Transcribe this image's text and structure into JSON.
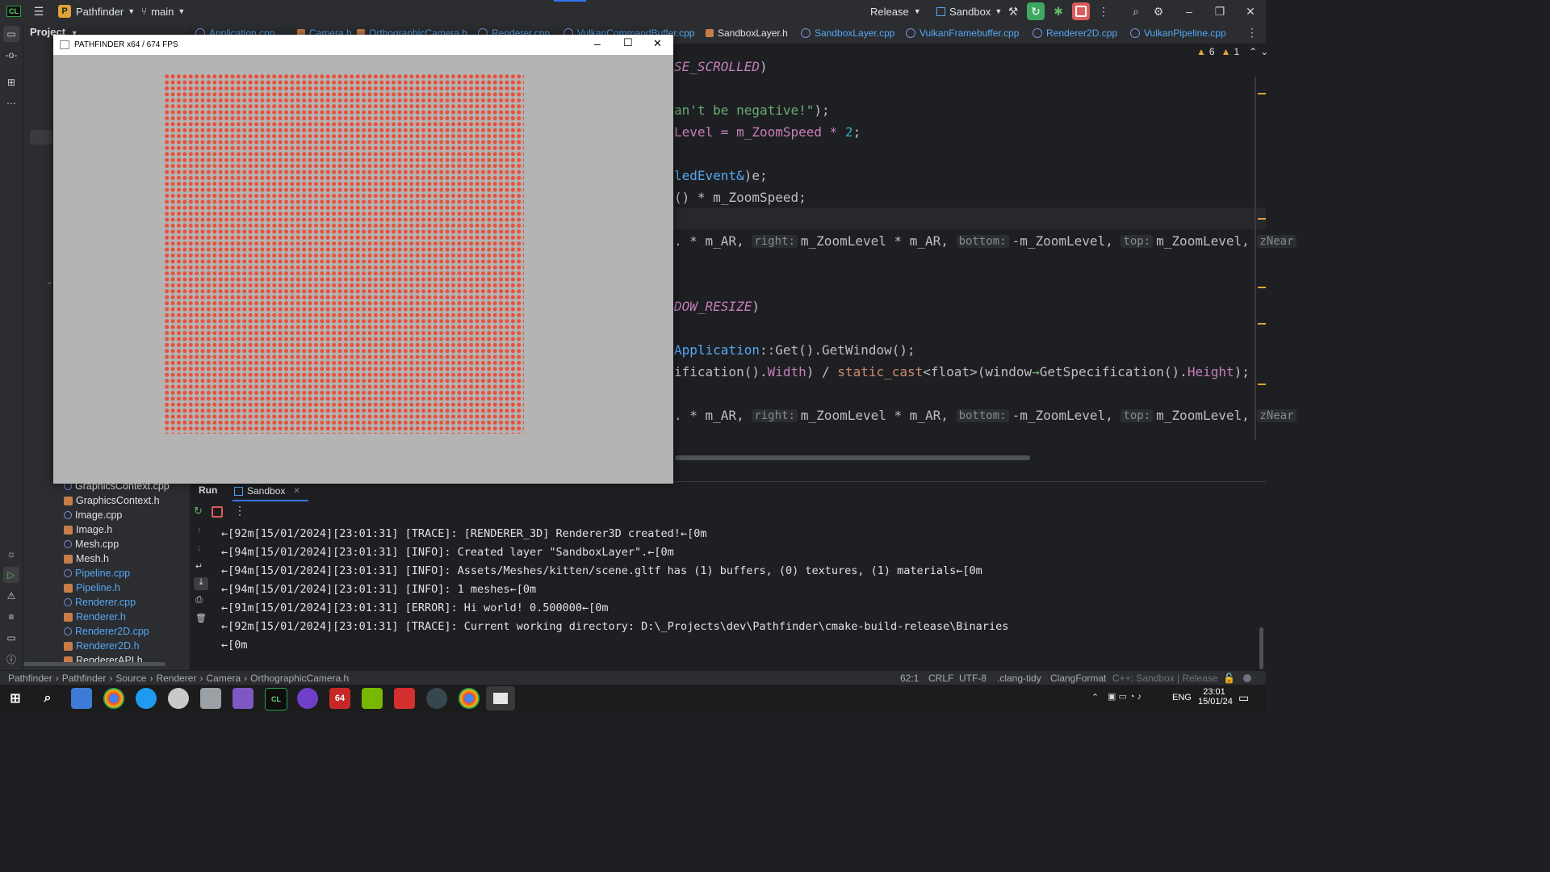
{
  "titlebar": {
    "app_badge": "CL",
    "project_badge": "P",
    "project_name": "Pathfinder",
    "branch": "main",
    "config": "Release",
    "run_target": "Sandbox"
  },
  "sidebar": {
    "project_label": "Project"
  },
  "tabs": [
    {
      "label": "Application.cpp",
      "type": "cpp"
    },
    {
      "label": "Camera.h",
      "type": "h"
    },
    {
      "label": "OrthographicCamera.h",
      "type": "h"
    },
    {
      "label": "Renderer.cpp",
      "type": "cpp"
    },
    {
      "label": "VulkanCommandBuffer.cpp",
      "type": "cpp"
    },
    {
      "label": "SandboxLayer.h",
      "type": "h"
    },
    {
      "label": "SandboxLayer.cpp",
      "type": "cpp"
    },
    {
      "label": "VulkanFramebuffer.cpp",
      "type": "cpp"
    },
    {
      "label": "Renderer2D.cpp",
      "type": "cpp"
    },
    {
      "label": "VulkanPipeline.cpp",
      "type": "cpp"
    }
  ],
  "inspections": {
    "warnings": "6",
    "weak_warnings": "1"
  },
  "code": {
    "l1": "SE_SCROLLED",
    "l2a": "an't be negative!\"",
    "l3a": "Level = m_ZoomSpeed * ",
    "l3b": "2",
    "l4a": "ledEvent&",
    "l4b": ")e;",
    "l5": "() * m_ZoomSpeed;",
    "l6a": ". * m_AR, ",
    "hint_right": "right:",
    "l6b": "m_ZoomLevel * m_AR, ",
    "hint_bottom": "bottom:",
    "l6c": "-m_ZoomLevel, ",
    "hint_top": "top:",
    "l6d": "m_ZoomLevel, ",
    "hint_znear": "zNear",
    "l7": "DOW_RESIZE",
    "l8a": "Application",
    "l8b": "::Get().GetWindow();",
    "l9a": "ification().",
    "l9b": "Width",
    "l9c": ") / ",
    "l9d": "static_cast",
    "l9e": "<float>",
    "l9f": "(window",
    "l9g": "GetSpecification().",
    "l9h": "Height",
    "l9i": ");"
  },
  "project_tree": [
    {
      "label": "GraphicsContext.cpp",
      "type": "cpp",
      "vcs": false
    },
    {
      "label": "GraphicsContext.h",
      "type": "h",
      "vcs": false
    },
    {
      "label": "Image.cpp",
      "type": "cpp",
      "vcs": false
    },
    {
      "label": "Image.h",
      "type": "h",
      "vcs": false
    },
    {
      "label": "Mesh.cpp",
      "type": "cpp",
      "vcs": false
    },
    {
      "label": "Mesh.h",
      "type": "h",
      "vcs": false
    },
    {
      "label": "Pipeline.cpp",
      "type": "cpp",
      "vcs": true
    },
    {
      "label": "Pipeline.h",
      "type": "h",
      "vcs": true
    },
    {
      "label": "Renderer.cpp",
      "type": "cpp",
      "vcs": true
    },
    {
      "label": "Renderer.h",
      "type": "h",
      "vcs": true
    },
    {
      "label": "Renderer2D.cpp",
      "type": "cpp",
      "vcs": true
    },
    {
      "label": "Renderer2D.h",
      "type": "h",
      "vcs": true
    },
    {
      "label": "RendererAPI.h",
      "type": "h",
      "vcs": false
    }
  ],
  "run": {
    "title": "Run",
    "tab": "Sandbox",
    "logs": [
      "←[92m[15/01/2024][23:01:31] [TRACE]: [RENDERER_3D] Renderer3D created!←[0m",
      "←[94m[15/01/2024][23:01:31] [INFO]: Created layer \"SandboxLayer\".←[0m",
      "←[94m[15/01/2024][23:01:31] [INFO]: Assets/Meshes/kitten/scene.gltf has (1) buffers, (0) textures, (1) materials←[0m",
      "←[94m[15/01/2024][23:01:31] [INFO]: 1 meshes←[0m",
      "←[91m[15/01/2024][23:01:31] [ERROR]: Hi world! 0.500000←[0m",
      "←[92m[15/01/2024][23:01:31] [TRACE]: Current working directory: D:\\_Projects\\dev\\Pathfinder\\cmake-build-release\\Binaries",
      "←[0m"
    ]
  },
  "game_window": {
    "title": "PATHFINDER x64 / 674 FPS"
  },
  "statusbar": {
    "crumbs": [
      "Pathfinder",
      "Pathfinder",
      "Source",
      "Renderer",
      "Camera",
      "OrthographicCamera.h"
    ],
    "position": "62:1",
    "line_sep": "CRLF",
    "encoding": "UTF-8",
    "linter": ".clang-tidy",
    "formatter": "ClangFormat",
    "context": "C++: Sandbox | Release"
  },
  "taskbar": {
    "lang": "ENG",
    "time": "23:01",
    "date": "15/01/24"
  }
}
